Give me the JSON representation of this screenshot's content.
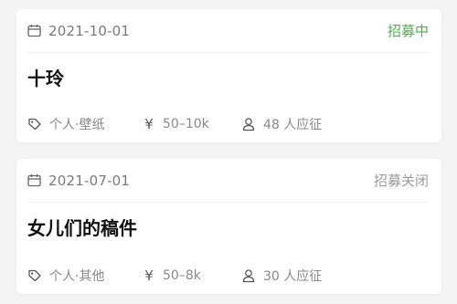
{
  "colors": {
    "recruiting": "#4caf50",
    "closed": "#9a9a9a",
    "background": "#f4f4f5"
  },
  "icons": {
    "date": "calendar-icon",
    "category": "tag-icon",
    "pay": "yen-icon",
    "applicants": "user-icon"
  },
  "jobs": [
    {
      "date": "2021-10-01",
      "status": "招募中",
      "status_type": "recruiting",
      "title": "十玲",
      "category": "个人·壁纸",
      "pay_symbol": "¥",
      "pay": "50–10k",
      "applicants": "48 人应征"
    },
    {
      "date": "2021-07-01",
      "status": "招募关闭",
      "status_type": "closed",
      "title": "女儿们的稿件",
      "category": "个人·其他",
      "pay_symbol": "¥",
      "pay": "50–8k",
      "applicants": "30 人应征"
    }
  ]
}
